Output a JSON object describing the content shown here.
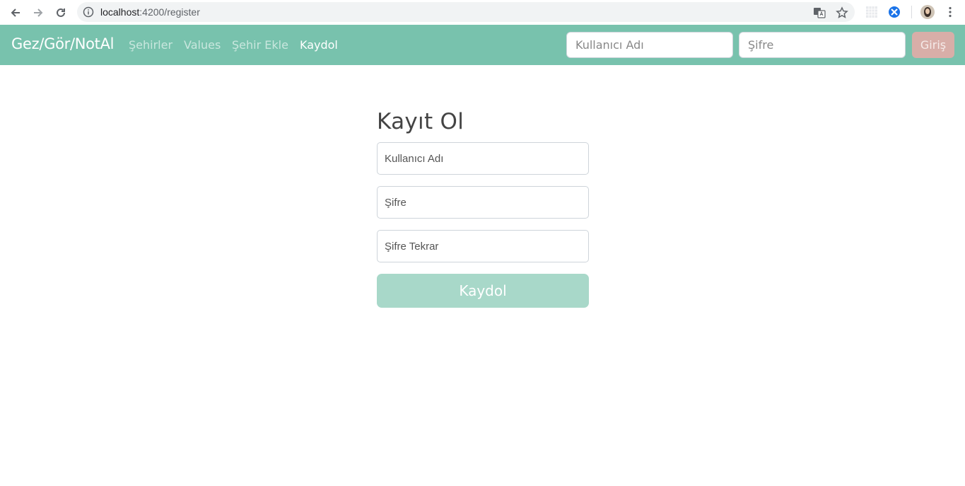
{
  "browser": {
    "url_host": "localhost",
    "url_path": ":4200/register"
  },
  "navbar": {
    "brand": "Gez/Gör/NotAl",
    "links": [
      {
        "label": "Şehirler",
        "active": false
      },
      {
        "label": "Values",
        "active": false
      },
      {
        "label": "Şehir Ekle",
        "active": false
      },
      {
        "label": "Kaydol",
        "active": true
      }
    ],
    "username_placeholder": "Kullanıcı Adı",
    "password_placeholder": "Şifre",
    "login_label": "Giriş"
  },
  "register": {
    "title": "Kayıt Ol",
    "username_placeholder": "Kullanıcı Adı",
    "password_placeholder": "Şifre",
    "password_repeat_placeholder": "Şifre Tekrar",
    "submit_label": "Kaydol"
  },
  "colors": {
    "primary": "#78c2ad",
    "primary_light": "#a8d8c9",
    "login_button": "#d8aea8"
  }
}
